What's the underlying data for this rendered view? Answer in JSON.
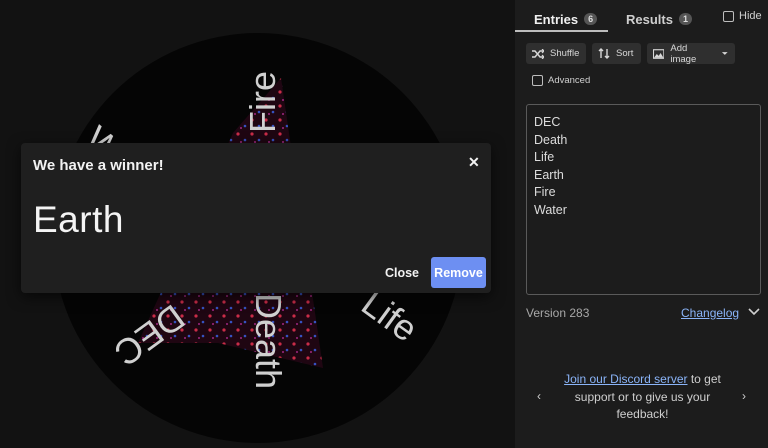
{
  "wheel": {
    "slices": [
      "Fire",
      "Life",
      "Death",
      "DEC",
      "Water"
    ]
  },
  "panel": {
    "tabs": [
      {
        "label": "Entries",
        "count": "6"
      },
      {
        "label": "Results",
        "count": "1"
      }
    ],
    "hide_label": "Hide",
    "buttons": {
      "shuffle": "Shuffle",
      "sort": "Sort",
      "add_image": "Add image"
    },
    "advanced_label": "Advanced",
    "entries": [
      "DEC",
      "Death",
      "Life",
      "Earth",
      "Fire",
      "Water"
    ],
    "version": "Version 283",
    "changelog": "Changelog",
    "discord_link": "Join our Discord server",
    "discord_text": " to get support or to give us your feedback!",
    "arrow_left": "‹",
    "arrow_right": "›"
  },
  "dialog": {
    "title": "We have a winner!",
    "close_x": "✕",
    "winner": "Earth",
    "close_label": "Close",
    "remove_label": "Remove"
  },
  "colors": {
    "background": "#121212",
    "panel": "#1c1c1c",
    "accent": "#6d8ff2",
    "link": "#8ab4f8"
  }
}
